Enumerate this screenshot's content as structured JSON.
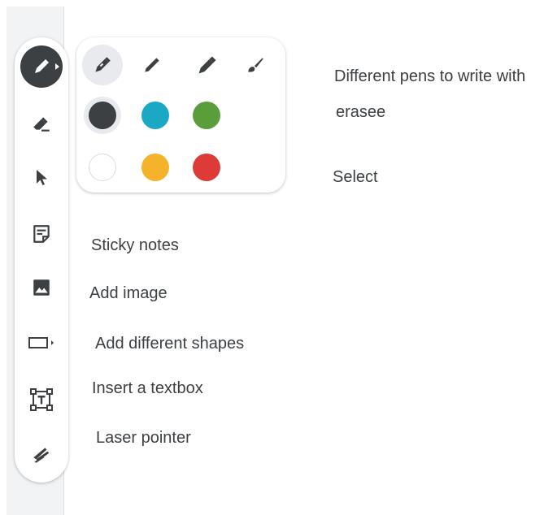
{
  "toolbar": {
    "tools": [
      {
        "name": "pen",
        "icon": "pen-icon",
        "active": true
      },
      {
        "name": "eraser",
        "icon": "eraser-icon"
      },
      {
        "name": "select",
        "icon": "cursor-icon"
      },
      {
        "name": "sticky-note",
        "icon": "sticky-note-icon"
      },
      {
        "name": "image",
        "icon": "image-icon"
      },
      {
        "name": "shape",
        "icon": "rectangle-icon"
      },
      {
        "name": "textbox",
        "icon": "textbox-icon"
      },
      {
        "name": "laser",
        "icon": "laser-pointer-icon"
      }
    ]
  },
  "palette": {
    "pens": [
      "felt-pen-icon",
      "marker-icon",
      "highlighter-icon",
      "brush-icon"
    ],
    "colors": [
      "#3c4043",
      "#1ba8c4",
      "#5a9e3c",
      "#ffffff",
      "#f4b32a",
      "#dc3b37"
    ]
  },
  "labels": {
    "pens": "Different pens to write with",
    "eraser": "erasee",
    "select": "Select",
    "sticky": "Sticky notes",
    "image": "Add image",
    "shapes": "Add different shapes",
    "textbox": "Insert a textbox",
    "laser": "Laser pointer"
  },
  "colors": {
    "icon": "#3c4043",
    "active_bg": "#3c4043",
    "selected_bg": "#e8eaed"
  }
}
